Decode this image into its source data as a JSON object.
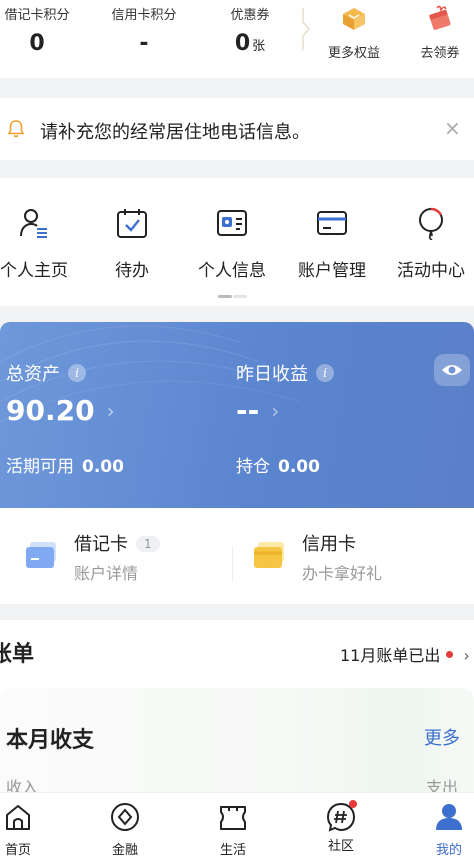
{
  "points": [
    {
      "label": "借记卡积分",
      "value": "0",
      "unit": ""
    },
    {
      "label": "信用卡积分",
      "value": "-",
      "unit": ""
    },
    {
      "label": "优惠券",
      "value": "0",
      "unit": "张"
    }
  ],
  "perks": [
    {
      "label": "更多权益",
      "icon": "gift-box-icon"
    },
    {
      "label": "去领券",
      "icon": "coupon-gift-icon"
    }
  ],
  "notice": {
    "text": "请补充您的经常居住地电话信息。",
    "close": "×"
  },
  "menu": [
    {
      "label": "个人主页",
      "icon": "person-list-icon"
    },
    {
      "label": "待办",
      "icon": "calendar-check-icon"
    },
    {
      "label": "个人信息",
      "icon": "id-card-icon"
    },
    {
      "label": "账户管理",
      "icon": "card-icon"
    },
    {
      "label": "活动中心",
      "icon": "balloon-icon"
    }
  ],
  "assets": {
    "total_label": "总资产",
    "total_value": "90.20",
    "yesterday_label": "昨日收益",
    "yesterday_value": "--",
    "current_label": "活期可用",
    "current_value": "0.00",
    "holding_label": "持仓",
    "holding_value": "0.00",
    "info_glyph": "i",
    "chevron": "›"
  },
  "cards": {
    "debit": {
      "title": "借记卡",
      "count": "1",
      "subtitle": "账户详情"
    },
    "credit": {
      "title": "信用卡",
      "subtitle": "办卡拿好礼"
    }
  },
  "bill": {
    "title": "账单",
    "status": "11月账单已出",
    "chevron": "›",
    "month_title": "本月收支",
    "more": "更多",
    "income": "收入",
    "expense": "支出"
  },
  "tabs": [
    {
      "label": "首页",
      "icon": "home-icon",
      "active": false
    },
    {
      "label": "金融",
      "icon": "finance-icon",
      "active": false
    },
    {
      "label": "生活",
      "icon": "life-ticket-icon",
      "active": false
    },
    {
      "label": "社区",
      "icon": "community-hash-icon",
      "active": false
    },
    {
      "label": "我的",
      "icon": "profile-icon",
      "active": true
    }
  ],
  "colors": {
    "accent": "#3d6fcf",
    "asset_card": "#5b85cf",
    "notice_bell": "#f0a030",
    "alert_red": "#e83a3a"
  }
}
